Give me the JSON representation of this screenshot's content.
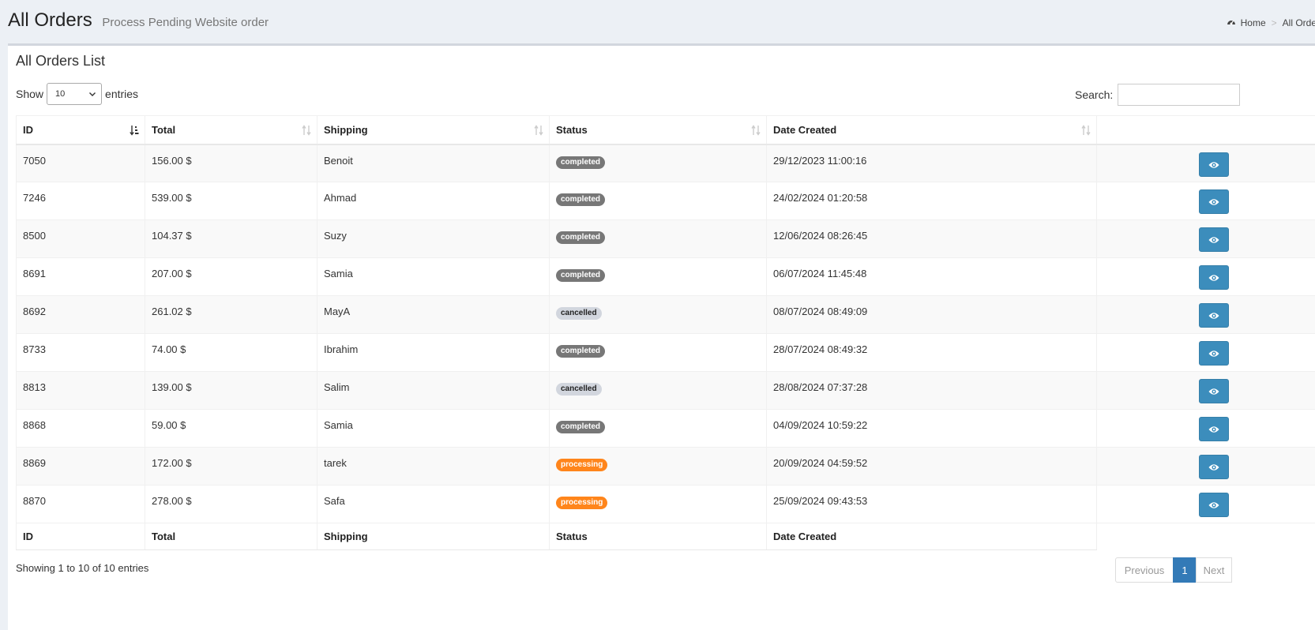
{
  "header": {
    "title": "All Orders",
    "subtitle": "Process Pending Website order",
    "breadcrumb": {
      "home": "Home",
      "separator": ">",
      "current": "All Order"
    }
  },
  "box": {
    "title": "All Orders List"
  },
  "length": {
    "show_label": "Show",
    "selected": "10",
    "entries_label": "entries"
  },
  "search": {
    "label": "Search:",
    "value": ""
  },
  "table": {
    "columns": [
      "ID",
      "Total",
      "Shipping",
      "Status",
      "Date Created",
      ""
    ],
    "rows": [
      {
        "id": "7050",
        "total": "156.00 $",
        "shipping": "Benoit",
        "status": "completed",
        "date": "29/12/2023 11:00:16"
      },
      {
        "id": "7246",
        "total": "539.00 $",
        "shipping": "Ahmad",
        "status": "completed",
        "date": "24/02/2024 01:20:58"
      },
      {
        "id": "8500",
        "total": "104.37 $",
        "shipping": "Suzy",
        "status": "completed",
        "date": "12/06/2024 08:26:45"
      },
      {
        "id": "8691",
        "total": "207.00 $",
        "shipping": "Samia",
        "status": "completed",
        "date": "06/07/2024 11:45:48"
      },
      {
        "id": "8692",
        "total": "261.02 $",
        "shipping": "MayA",
        "status": "cancelled",
        "date": "08/07/2024 08:49:09"
      },
      {
        "id": "8733",
        "total": "74.00 $",
        "shipping": "Ibrahim",
        "status": "completed",
        "date": "28/07/2024 08:49:32"
      },
      {
        "id": "8813",
        "total": "139.00 $",
        "shipping": "Salim",
        "status": "cancelled",
        "date": "28/08/2024 07:37:28"
      },
      {
        "id": "8868",
        "total": "59.00 $",
        "shipping": "Samia",
        "status": "completed",
        "date": "04/09/2024 10:59:22"
      },
      {
        "id": "8869",
        "total": "172.00 $",
        "shipping": "tarek",
        "status": "processing",
        "date": "20/09/2024 04:59:52"
      },
      {
        "id": "8870",
        "total": "278.00 $",
        "shipping": "Safa",
        "status": "processing",
        "date": "25/09/2024 09:43:53"
      }
    ],
    "footer": [
      "ID",
      "Total",
      "Shipping",
      "Status",
      "Date Created"
    ]
  },
  "status_colors": {
    "completed": "#777777",
    "cancelled": "#d2d6de",
    "processing": "#ff851b"
  },
  "icons": {
    "breadcrumb": "dashboard-icon",
    "action": "eye-icon",
    "sort": "sort-icon"
  },
  "info": "Showing 1 to 10 of 10 entries",
  "pagination": {
    "previous": "Previous",
    "current": "1",
    "next": "Next"
  },
  "colors": {
    "primary": "#3c8dbc",
    "page_active": "#337ab7",
    "background": "#ecf0f5"
  }
}
